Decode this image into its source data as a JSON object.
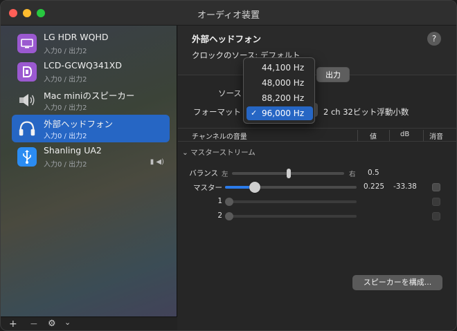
{
  "window": {
    "title": "オーディオ装置"
  },
  "devices": [
    {
      "name": "LG HDR WQHD",
      "sub": "入力0 / 出力2",
      "icon": "display-icon",
      "color": "#9b59d0"
    },
    {
      "name": "LCD-GCWQ341XD",
      "sub": "入力0 / 出力2",
      "icon": "displayport-icon",
      "color": "#9b59d0"
    },
    {
      "name": "Mac miniのスピーカー",
      "sub": "入力0 / 出力2",
      "icon": "speaker-icon",
      "color": "#9e9e9e"
    },
    {
      "name": "外部ヘッドフォン",
      "sub": "入力0 / 出力2",
      "icon": "headphones-icon",
      "color": "#ffffff",
      "selected": true
    },
    {
      "name": "Shanling UA2",
      "sub": "入力0 / 出力2",
      "icon": "usb-icon",
      "color": "#2b8cf2",
      "extra": "▮ ◀)"
    }
  ],
  "sidebar_footer": {
    "add": "+",
    "remove": "−",
    "gear": "⚙",
    "chevron": "⌄"
  },
  "main": {
    "title": "外部ヘッドフォン",
    "help": "?",
    "clock_label": "クロックのソース:  デフォルト",
    "tabs": [
      {
        "label": "出力",
        "active": true
      }
    ],
    "source_label": "ソース",
    "format_label": "フォーマット",
    "format_channels": "2 ch 32ビット浮動小数",
    "columns": {
      "channel": "チャンネルの音量",
      "value": "値",
      "db": "dB",
      "mute": "消音"
    },
    "group": "マスターストリーム",
    "balance": {
      "label": "バランス",
      "left": "左",
      "right": "右",
      "value": "0.5"
    },
    "master": {
      "label": "マスター",
      "value": "0.225",
      "db": "-33.38",
      "level": 0.225
    },
    "channels": [
      {
        "label": "1"
      },
      {
        "label": "2"
      }
    ],
    "config_button": "スピーカーを構成..."
  },
  "popup": {
    "items": [
      {
        "label": "44,100 Hz"
      },
      {
        "label": "48,000 Hz"
      },
      {
        "label": "88,200 Hz"
      },
      {
        "label": "96,000 Hz",
        "selected": true
      }
    ],
    "check": "✓"
  }
}
